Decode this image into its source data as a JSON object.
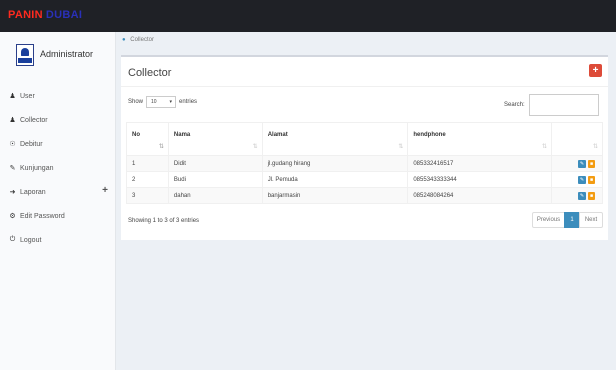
{
  "brand": {
    "part1": "PANIN",
    "part2": "DUBAI"
  },
  "sidebar": {
    "admin_name": "Administrator",
    "items": [
      {
        "label": "User",
        "icon": "user-icon"
      },
      {
        "label": "Collector",
        "icon": "users-icon"
      },
      {
        "label": "Debitur",
        "icon": "user-circle-icon"
      },
      {
        "label": "Kunjungan",
        "icon": "edit-icon"
      },
      {
        "label": "Laporan",
        "icon": "sign-in-icon",
        "expand": "+"
      },
      {
        "label": "Edit Password",
        "icon": "cogs-icon"
      },
      {
        "label": "Logout",
        "icon": "power-icon"
      }
    ]
  },
  "breadcrumb": {
    "current": "Collector"
  },
  "box": {
    "title": "Collector",
    "add_label": "+",
    "length": {
      "show": "Show",
      "value": "10",
      "entries": "entries"
    },
    "search_label": "Search:",
    "table": {
      "headers": [
        "No",
        "Nama",
        "Alamat",
        "hendphone",
        ""
      ],
      "rows": [
        [
          "1",
          "Didit",
          "jl.gudang hirang",
          "085332416517"
        ],
        [
          "2",
          "Budi",
          "Jl. Pemuda",
          "0855343333344"
        ],
        [
          "3",
          "dahan",
          "banjarmasin",
          "085248084264"
        ]
      ]
    },
    "info": "Showing 1 to 3 of 3 entries",
    "pagination": {
      "prev": "Previous",
      "current": "1",
      "next": "Next"
    }
  },
  "colors": {
    "topbar": "#1f2126",
    "brand_red": "#ff2a1f",
    "brand_blue": "#2a30b8",
    "primary": "#3c8dbc",
    "danger": "#dd4b39",
    "warning": "#f39c12"
  }
}
